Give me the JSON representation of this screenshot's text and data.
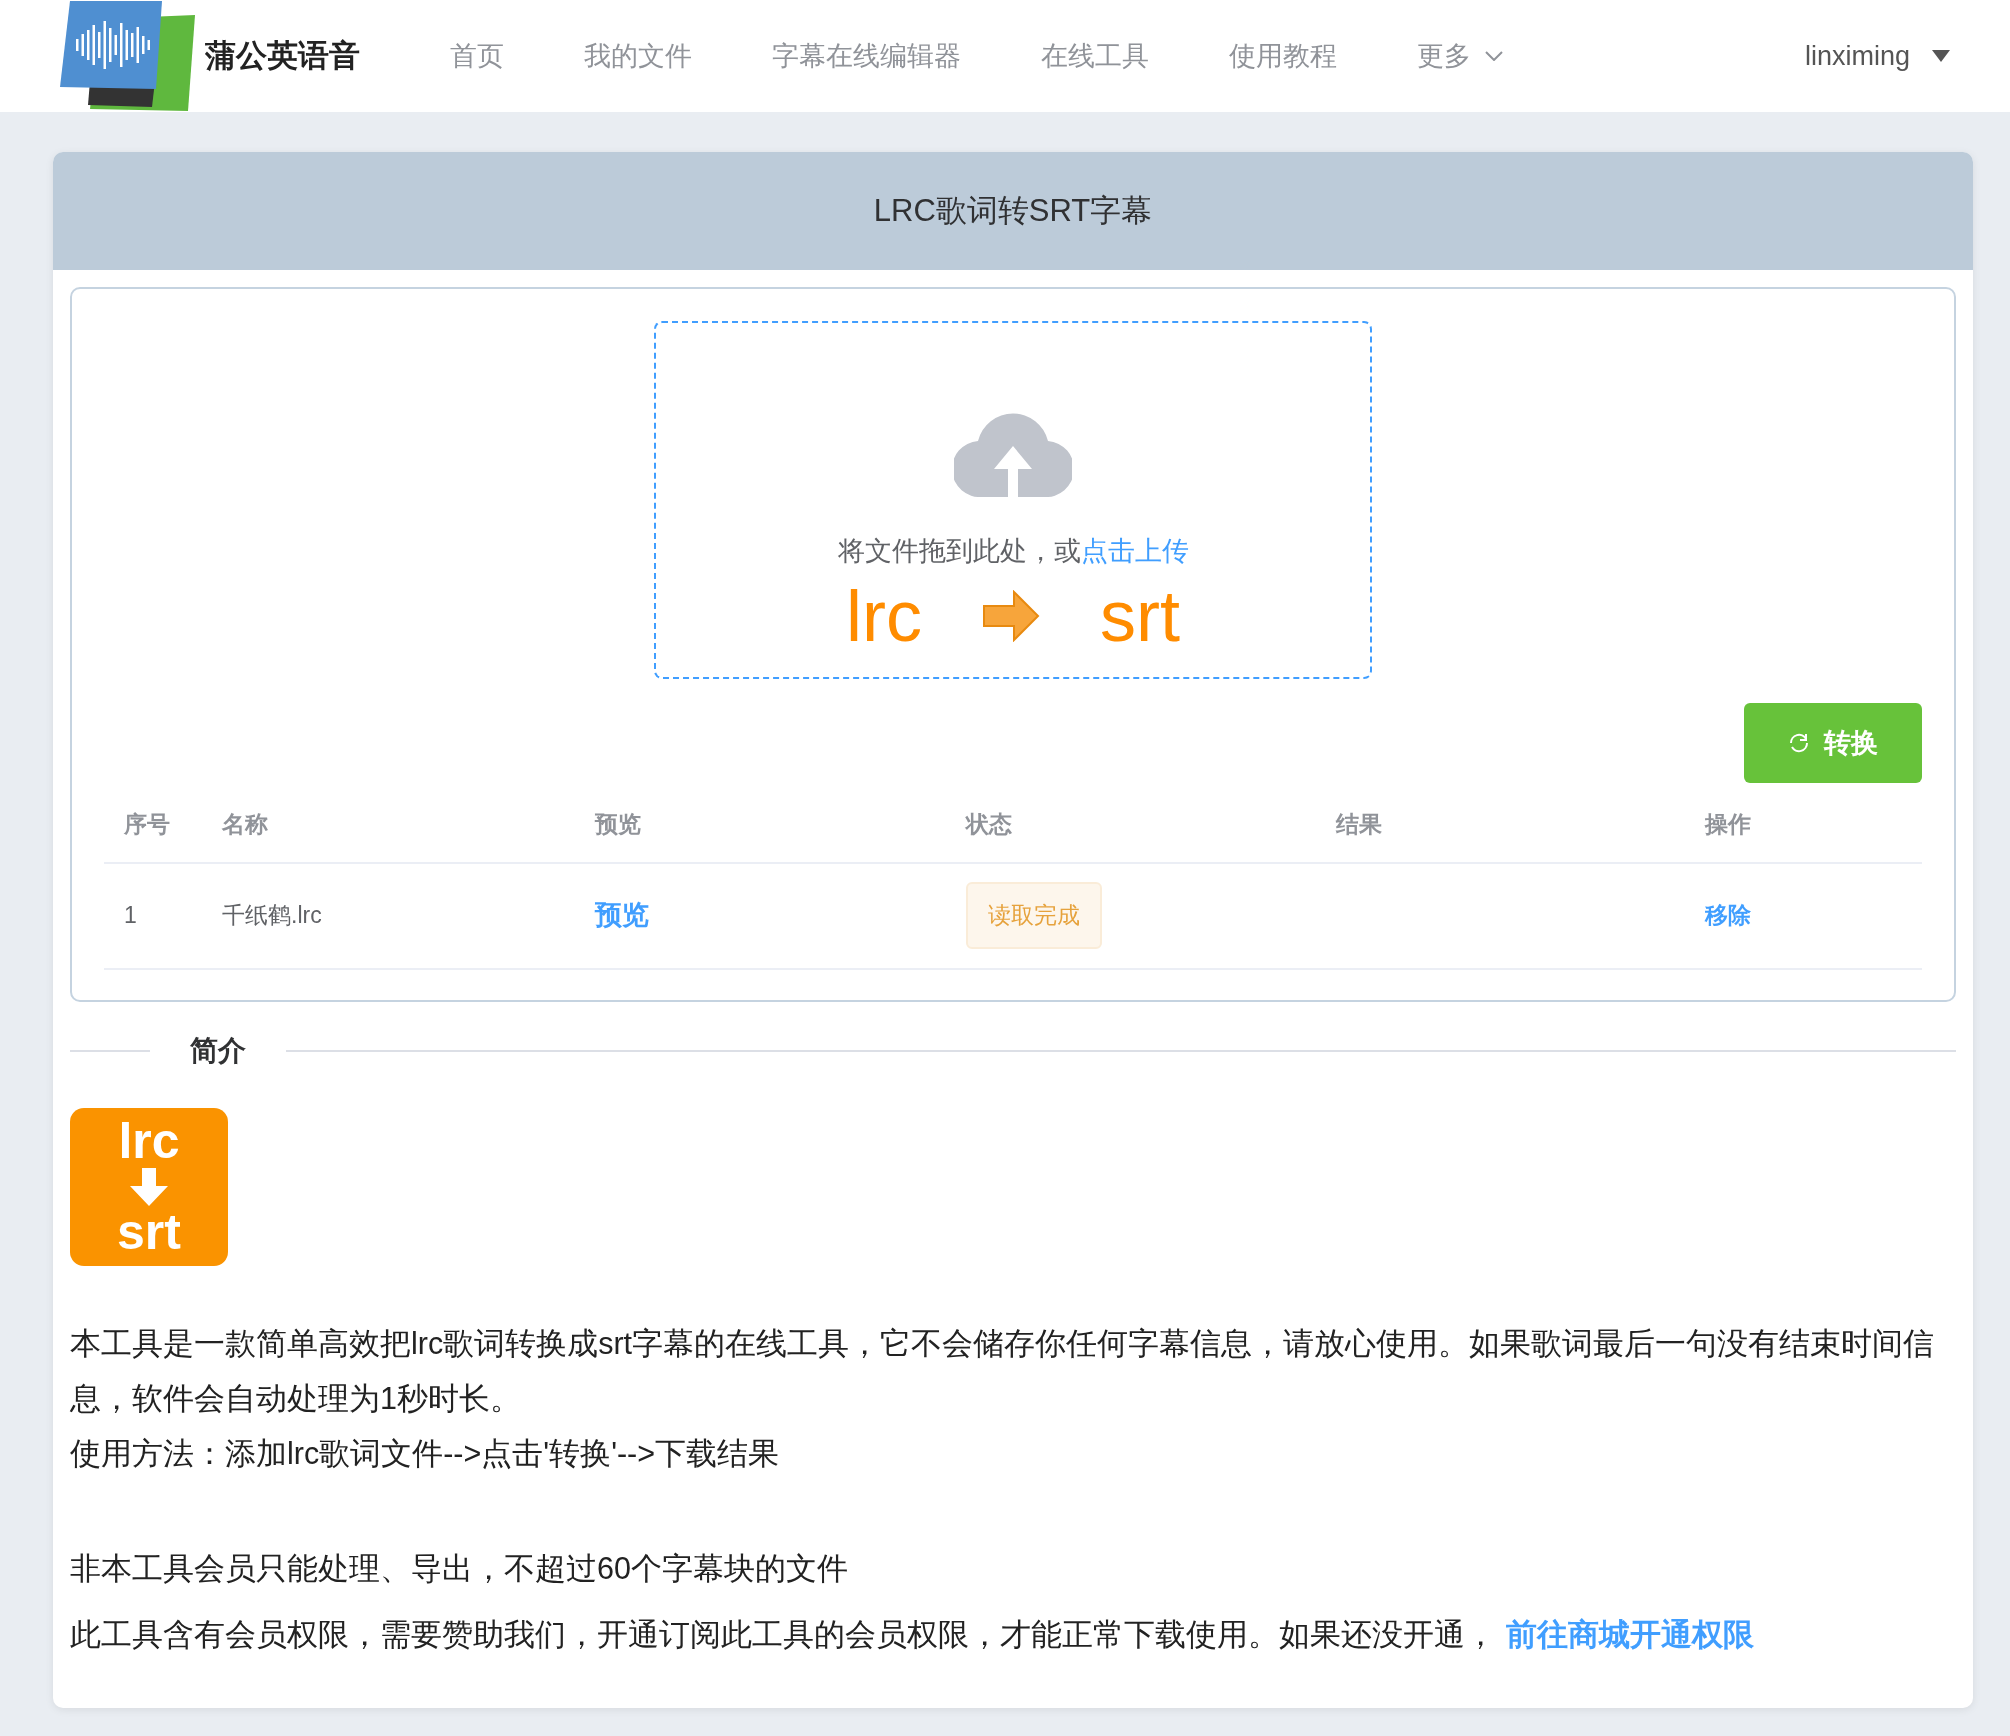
{
  "navbar": {
    "brand": "蒲公英语音",
    "items": [
      {
        "label": "首页",
        "dropdown": false
      },
      {
        "label": "我的文件",
        "dropdown": false
      },
      {
        "label": "字幕在线编辑器",
        "dropdown": false
      },
      {
        "label": "在线工具",
        "dropdown": false
      },
      {
        "label": "使用教程",
        "dropdown": false
      },
      {
        "label": "更多",
        "dropdown": true
      }
    ],
    "user": "linximing"
  },
  "panel": {
    "title": "LRC歌词转SRT字幕"
  },
  "upload": {
    "hint": "将文件拖到此处，或",
    "link": "点击上传",
    "from": "lrc",
    "to": "srt"
  },
  "convert_button": "转换",
  "table": {
    "columns": [
      "序号",
      "名称",
      "预览",
      "状态",
      "结果",
      "操作"
    ],
    "rows": [
      {
        "index": "1",
        "name": "千纸鹤.lrc",
        "preview": "预览",
        "status": "读取完成",
        "action": "移除"
      }
    ]
  },
  "intro": {
    "heading": "简介",
    "icon_top": "lrc",
    "icon_bottom": "srt",
    "sections": [
      {
        "lines": [
          {
            "text": "本工具是一款简单高效把lrc歌词转换成srt字幕的在线工具，它不会储存你任何字幕信息，请放心使用。如果歌词最后一句没有结束时间信息，软件会自动处理为1秒时长。"
          },
          {
            "text": "使用方法：添加lrc歌词文件-->点击'转换'-->下载结果"
          }
        ]
      },
      {
        "lines": [
          {
            "text": "非本工具会员只能处理、导出，不超过60个字幕块的文件"
          },
          {
            "text": "此工具含有会员权限，需要赞助我们，开通订阅此工具的会员权限，才能正常下载使用。如果还没开通，",
            "link": "前往商城开通权限"
          }
        ]
      }
    ]
  }
}
